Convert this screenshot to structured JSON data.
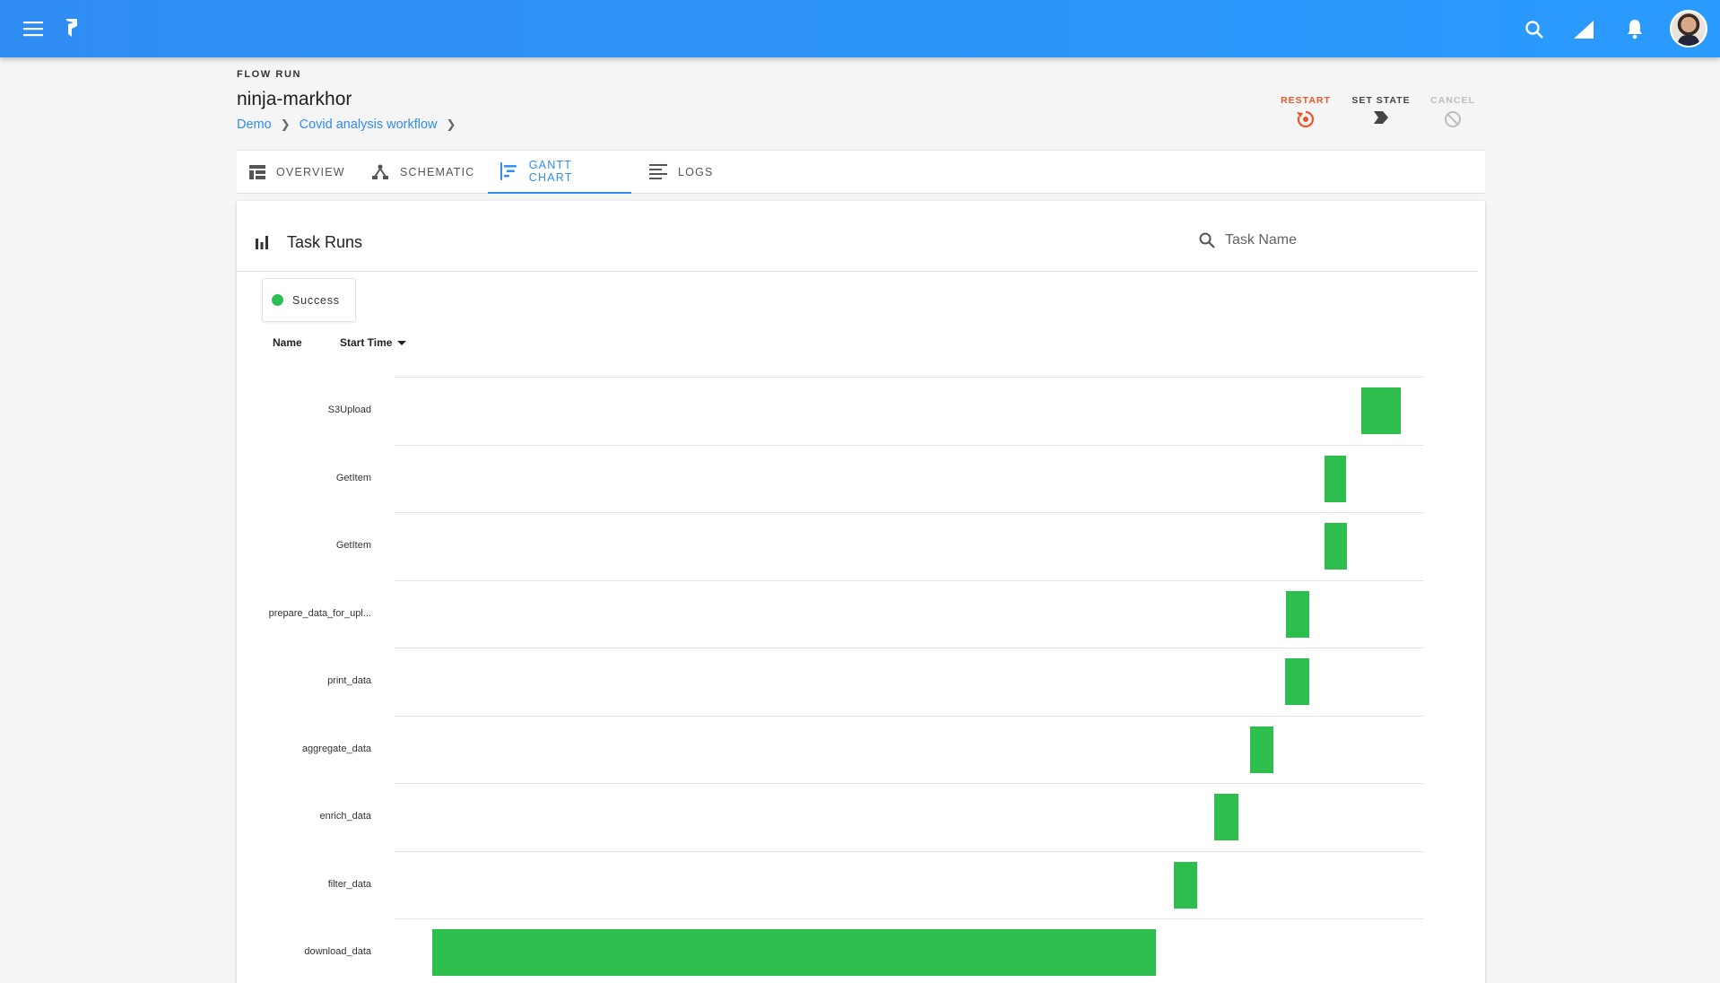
{
  "header": {
    "eyebrow": "FLOW RUN",
    "title": "ninja-markhor",
    "breadcrumb": [
      "Demo",
      "Covid analysis workflow"
    ]
  },
  "actions": {
    "restart": "RESTART",
    "set_state": "SET STATE",
    "cancel": "CANCEL"
  },
  "tabs": [
    {
      "label": "OVERVIEW",
      "icon": "dashboard-icon",
      "active": false
    },
    {
      "label": "SCHEMATIC",
      "icon": "schematic-icon",
      "active": false
    },
    {
      "label": "GANTT CHART",
      "icon": "gantt-icon",
      "active": true
    },
    {
      "label": "LOGS",
      "icon": "logs-icon",
      "active": false
    }
  ],
  "card": {
    "title": "Task Runs",
    "search_placeholder": "Task Name",
    "legend": "Success",
    "columns": {
      "name": "Name",
      "start": "Start Time"
    }
  },
  "colors": {
    "appbar": "#2a9bff",
    "accent": "#2f8cf2",
    "restart": "#e8562a",
    "success": "#2dbe4e"
  },
  "chart_data": {
    "type": "gantt",
    "status": "Success",
    "tasks": [
      {
        "name": "S3Upload",
        "start": 0.94,
        "end": 0.978
      },
      {
        "name": "GetItem",
        "start": 0.904,
        "end": 0.925
      },
      {
        "name": "GetItem",
        "start": 0.904,
        "end": 0.926
      },
      {
        "name": "prepare_data_for_upl...",
        "start": 0.867,
        "end": 0.889
      },
      {
        "name": "print_data",
        "start": 0.866,
        "end": 0.889
      },
      {
        "name": "aggregate_data",
        "start": 0.832,
        "end": 0.854
      },
      {
        "name": "enrich_data",
        "start": 0.797,
        "end": 0.82
      },
      {
        "name": "filter_data",
        "start": 0.758,
        "end": 0.78
      },
      {
        "name": "download_data",
        "start": 0.037,
        "end": 0.74
      }
    ]
  }
}
